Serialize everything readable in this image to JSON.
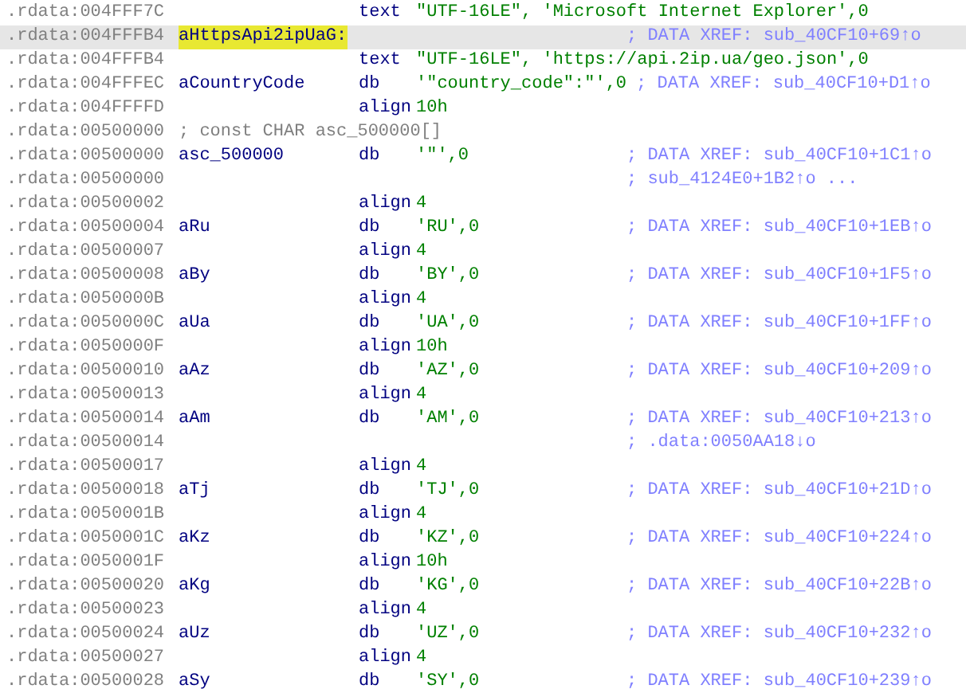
{
  "listing": {
    "rows": [
      {
        "address": ".rdata:004FFF7C",
        "mnemonic": "text",
        "operand": "\"UTF-16LE\", 'Microsoft Internet Explorer',0",
        "selected": false
      },
      {
        "address": ".rdata:004FFFB4",
        "label": "aHttpsApi2ipUaG:",
        "label_highlighted": true,
        "comment": "; DATA XREF: sub_40CF10+69↑o",
        "selected": true
      },
      {
        "address": ".rdata:004FFFB4",
        "mnemonic": "text",
        "operand": "\"UTF-16LE\", 'https://api.2ip.ua/geo.json',0",
        "selected": false
      },
      {
        "address": ".rdata:004FFFEC",
        "label": "aCountryCode",
        "mnemonic": "db",
        "operand": "'\"country_code\":\"',0",
        "comment": "; DATA XREF: sub_40CF10+D1↑o",
        "selected": false
      },
      {
        "address": ".rdata:004FFFFD",
        "mnemonic": "align",
        "operand": "10h",
        "selected": false
      },
      {
        "address": ".rdata:00500000",
        "note": "; const CHAR asc_500000[]",
        "selected": false
      },
      {
        "address": ".rdata:00500000",
        "label": "asc_500000",
        "mnemonic": "db",
        "operand": "'\"',0",
        "comment": "; DATA XREF: sub_40CF10+1C1↑o",
        "selected": false
      },
      {
        "address": ".rdata:00500000",
        "comment": "; sub_4124E0+1B2↑o ...",
        "selected": false
      },
      {
        "address": ".rdata:00500002",
        "mnemonic": "align",
        "operand": "4",
        "selected": false
      },
      {
        "address": ".rdata:00500004",
        "label": "aRu",
        "mnemonic": "db",
        "operand": "'RU',0",
        "comment": "; DATA XREF: sub_40CF10+1EB↑o",
        "selected": false
      },
      {
        "address": ".rdata:00500007",
        "mnemonic": "align",
        "operand": "4",
        "selected": false
      },
      {
        "address": ".rdata:00500008",
        "label": "aBy",
        "mnemonic": "db",
        "operand": "'BY',0",
        "comment": "; DATA XREF: sub_40CF10+1F5↑o",
        "selected": false
      },
      {
        "address": ".rdata:0050000B",
        "mnemonic": "align",
        "operand": "4",
        "selected": false
      },
      {
        "address": ".rdata:0050000C",
        "label": "aUa",
        "mnemonic": "db",
        "operand": "'UA',0",
        "comment": "; DATA XREF: sub_40CF10+1FF↑o",
        "selected": false
      },
      {
        "address": ".rdata:0050000F",
        "mnemonic": "align",
        "operand": "10h",
        "selected": false
      },
      {
        "address": ".rdata:00500010",
        "label": "aAz",
        "mnemonic": "db",
        "operand": "'AZ',0",
        "comment": "; DATA XREF: sub_40CF10+209↑o",
        "selected": false
      },
      {
        "address": ".rdata:00500013",
        "mnemonic": "align",
        "operand": "4",
        "selected": false
      },
      {
        "address": ".rdata:00500014",
        "label": "aAm",
        "mnemonic": "db",
        "operand": "'AM',0",
        "comment": "; DATA XREF: sub_40CF10+213↑o",
        "selected": false
      },
      {
        "address": ".rdata:00500014",
        "comment": "; .data:0050AA18↓o",
        "selected": false
      },
      {
        "address": ".rdata:00500017",
        "mnemonic": "align",
        "operand": "4",
        "selected": false
      },
      {
        "address": ".rdata:00500018",
        "label": "aTj",
        "mnemonic": "db",
        "operand": "'TJ',0",
        "comment": "; DATA XREF: sub_40CF10+21D↑o",
        "selected": false
      },
      {
        "address": ".rdata:0050001B",
        "mnemonic": "align",
        "operand": "4",
        "selected": false
      },
      {
        "address": ".rdata:0050001C",
        "label": "aKz",
        "mnemonic": "db",
        "operand": "'KZ',0",
        "comment": "; DATA XREF: sub_40CF10+224↑o",
        "selected": false
      },
      {
        "address": ".rdata:0050001F",
        "mnemonic": "align",
        "operand": "10h",
        "selected": false
      },
      {
        "address": ".rdata:00500020",
        "label": "aKg",
        "mnemonic": "db",
        "operand": "'KG',0",
        "comment": "; DATA XREF: sub_40CF10+22B↑o",
        "selected": false
      },
      {
        "address": ".rdata:00500023",
        "mnemonic": "align",
        "operand": "4",
        "selected": false
      },
      {
        "address": ".rdata:00500024",
        "label": "aUz",
        "mnemonic": "db",
        "operand": "'UZ',0",
        "comment": "; DATA XREF: sub_40CF10+232↑o",
        "selected": false
      },
      {
        "address": ".rdata:00500027",
        "mnemonic": "align",
        "operand": "4",
        "selected": false
      },
      {
        "address": ".rdata:00500028",
        "label": "aSy",
        "mnemonic": "db",
        "operand": "'SY',0",
        "comment": "; DATA XREF: sub_40CF10+239↑o",
        "selected": false
      }
    ]
  }
}
